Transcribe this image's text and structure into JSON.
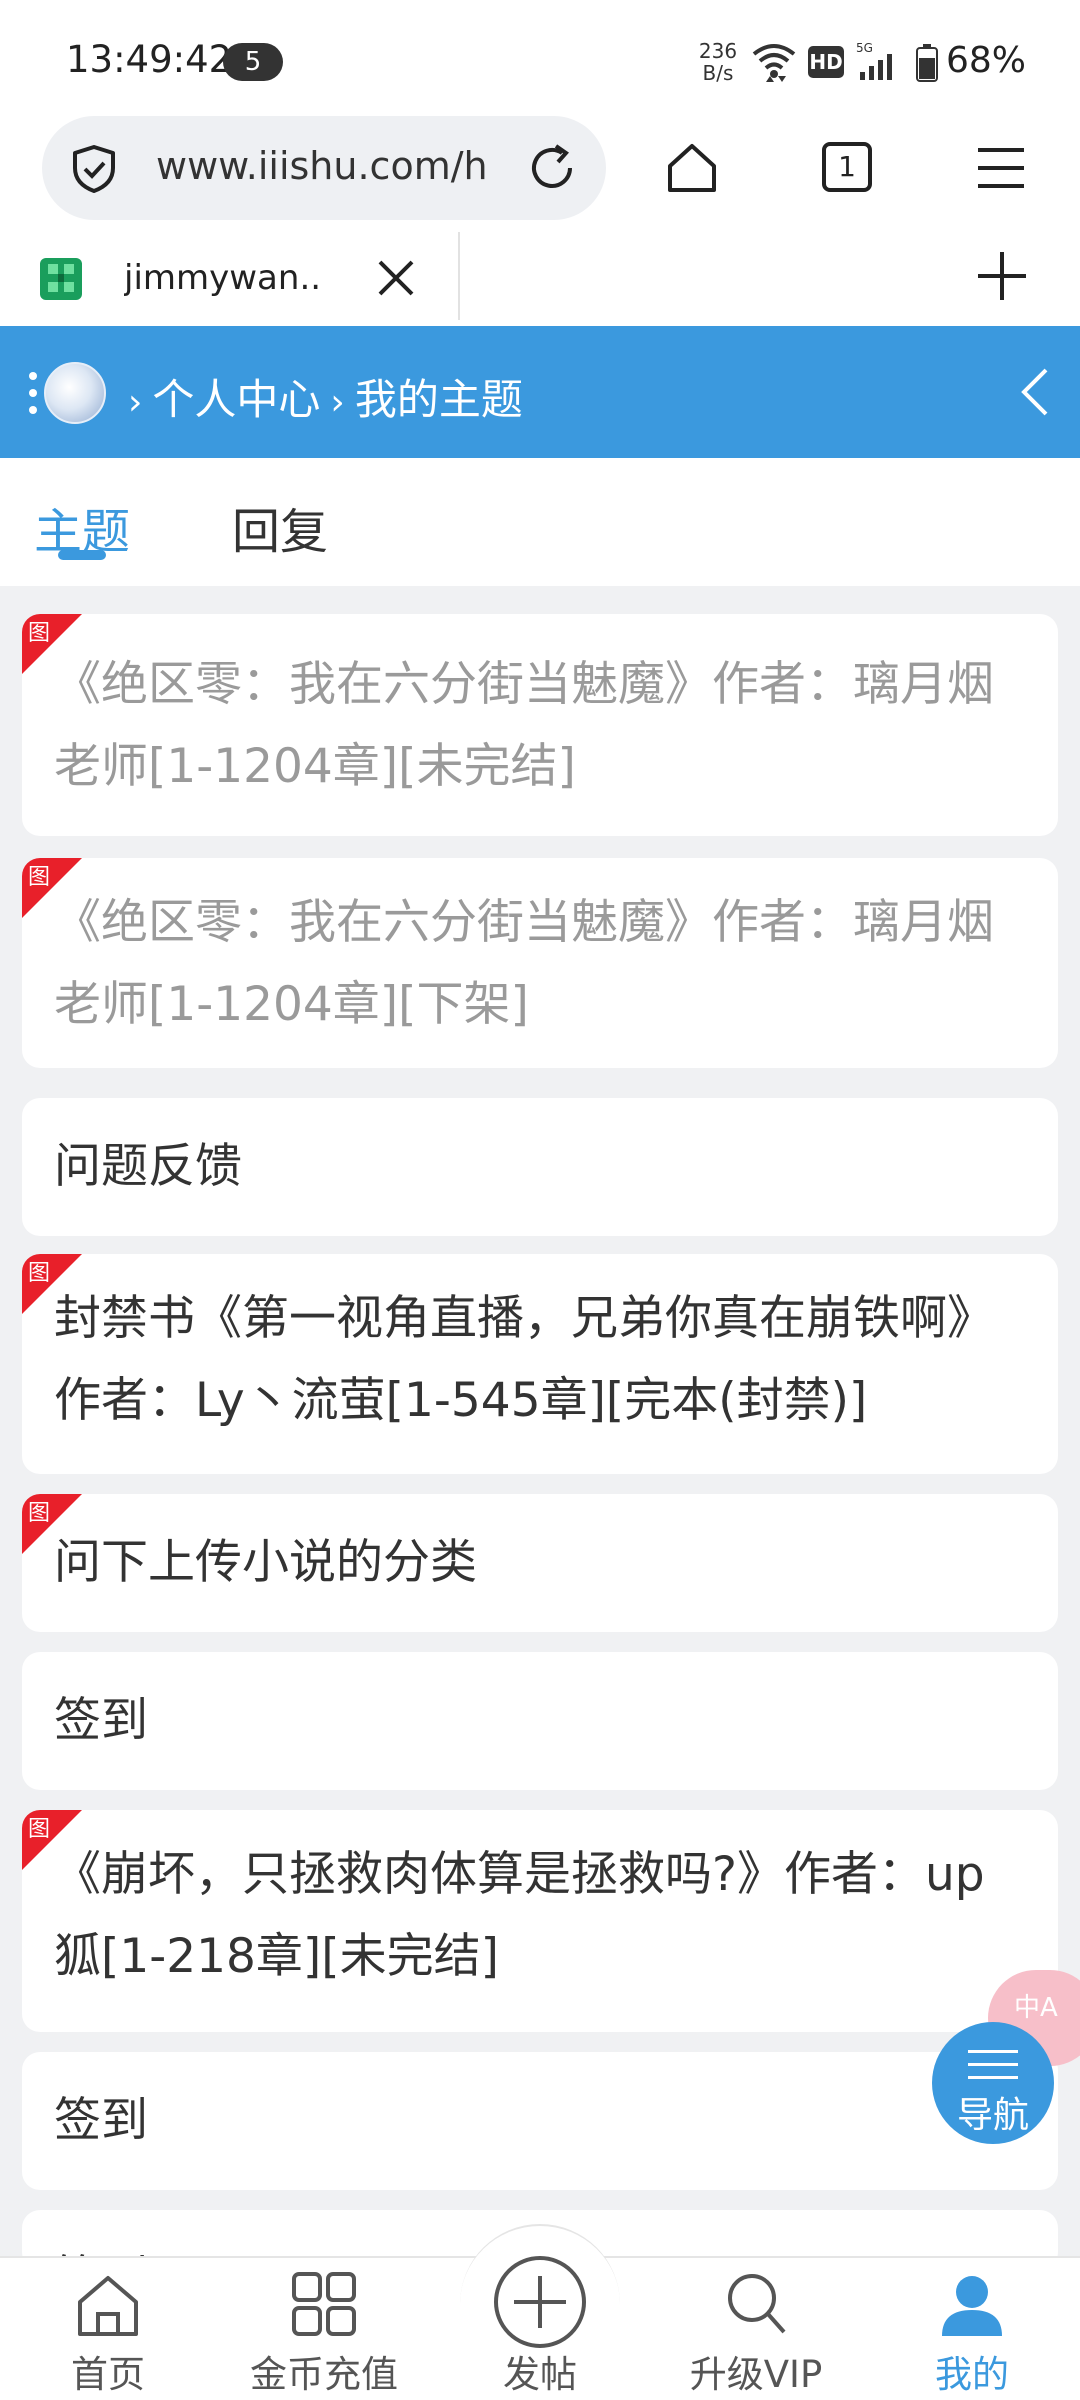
{
  "status_bar": {
    "time": "13:49:42",
    "notification_count": "5",
    "net_speed_value": "236",
    "net_speed_unit": "B/s",
    "hd_label": "HD",
    "network_type": "5G",
    "battery": "68%"
  },
  "browser": {
    "url": "www.iiishu.com/h",
    "tab_count": "1",
    "tab_title": "jimmywan..."
  },
  "header": {
    "breadcrumb_1": "个人中心",
    "breadcrumb_2": "我的主题",
    "separator": "›"
  },
  "subtabs": {
    "topics": "主题",
    "replies": "回复"
  },
  "posts": [
    {
      "title": "《绝区零：我在六分街当魅魔》作者：璃月烟老师[1-1204章][未完结]",
      "has_image": true,
      "dimmed": true
    },
    {
      "title": "《绝区零：我在六分街当魅魔》作者：璃月烟老师[1-1204章][下架]",
      "has_image": true,
      "dimmed": true
    },
    {
      "title": "问题反馈",
      "has_image": false,
      "dimmed": false
    },
    {
      "title": "封禁书《第一视角直播，兄弟你真在崩铁啊》作者：Ly丶流萤[1-545章][完本(封禁)]",
      "has_image": true,
      "dimmed": false
    },
    {
      "title": "问下上传小说的分类",
      "has_image": true,
      "dimmed": false
    },
    {
      "title": "签到",
      "has_image": false,
      "dimmed": false
    },
    {
      "title": "《崩坏，只拯救肉体算是拯救吗?》作者：up狐[1-218章][未完结]",
      "has_image": true,
      "dimmed": false
    },
    {
      "title": "签到",
      "has_image": false,
      "dimmed": false
    },
    {
      "title": "签到",
      "has_image": false,
      "dimmed": false
    }
  ],
  "pic_badge_label": "图",
  "floating": {
    "translate_label": "中A",
    "nav_label": "导航"
  },
  "bottom_nav": {
    "home": "首页",
    "recharge": "金币充值",
    "post": "发帖",
    "vip": "升级VIP",
    "mine": "我的"
  },
  "colors": {
    "accent": "#3b99de",
    "badge_red": "#e8202a",
    "background": "#f0f1f3"
  }
}
